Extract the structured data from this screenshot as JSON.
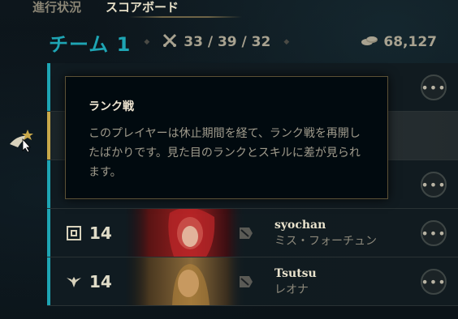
{
  "tabs": [
    {
      "label": "進行状況",
      "active": false
    },
    {
      "label": "スコアボード",
      "active": true
    }
  ],
  "team": {
    "name": "チーム 1",
    "kda": "33 / 39 / 32",
    "gold": "68,127",
    "color": "#1ea5b4"
  },
  "players": [
    {
      "role_icon": "support-role-icon",
      "level": "",
      "summoner": "",
      "champion": "",
      "highlighted": false
    },
    {
      "role_icon": "mid-role-icon",
      "level": "",
      "summoner": "",
      "champion": "",
      "highlighted": true
    },
    {
      "role_icon": "jungle-role-icon",
      "level": "",
      "summoner": "",
      "champion": "",
      "highlighted": false
    },
    {
      "role_icon": "top-role-icon",
      "level": "14",
      "summoner": "syochan",
      "champion": "ミス・フォーチュン",
      "highlighted": false
    },
    {
      "role_icon": "support-role-icon",
      "level": "14",
      "summoner": "Tsutsu",
      "champion": "レオナ",
      "highlighted": false
    }
  ],
  "tooltip": {
    "title": "ランク戦",
    "body": "このプレイヤーは休止期間を経て、ランク戦を再開したばかりです。見た目のランクとスキルに差が見られます。"
  },
  "colors": {
    "highlight_bar": "#c8a84a",
    "tooltip_border": "#5c5236"
  }
}
